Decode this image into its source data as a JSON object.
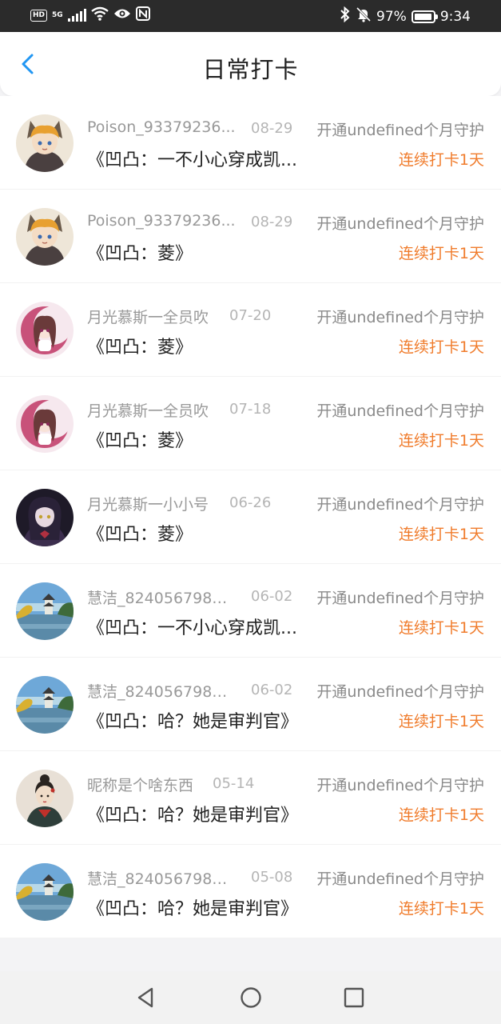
{
  "status_bar": {
    "hd_badge": "HD",
    "network": "5G",
    "battery_percent": "97%",
    "battery_level": 0.97,
    "time": "9:34",
    "icons": [
      "signal-icon",
      "wifi-icon",
      "eye-icon",
      "nfc-icon",
      "bluetooth-icon",
      "bell-off-icon",
      "battery-icon"
    ]
  },
  "header": {
    "title": "日常打卡",
    "back_icon": "chevron-left-icon",
    "accent_color": "#2196f3"
  },
  "checkins": [
    {
      "name": "Poison_93379236...",
      "date": "08-29",
      "guard": "开通undefined个月守护",
      "book": "《凹凸：一不小心穿成凯...",
      "streak": "连续打卡1天",
      "avatar": "anime-catboy"
    },
    {
      "name": "Poison_93379236...",
      "date": "08-29",
      "guard": "开通undefined个月守护",
      "book": "《凹凸：菱》",
      "streak": "连续打卡1天",
      "avatar": "anime-catboy"
    },
    {
      "name": "月光慕斯一全员吹",
      "date": "07-20",
      "guard": "开通undefined个月守护",
      "book": "《凹凸：菱》",
      "streak": "连续打卡1天",
      "avatar": "anime-pink-moon"
    },
    {
      "name": "月光慕斯一全员吹",
      "date": "07-18",
      "guard": "开通undefined个月守护",
      "book": "《凹凸：菱》",
      "streak": "连续打卡1天",
      "avatar": "anime-pink-moon"
    },
    {
      "name": "月光慕斯一小小号",
      "date": "06-26",
      "guard": "开通undefined个月守护",
      "book": "《凹凸：菱》",
      "streak": "连续打卡1天",
      "avatar": "anime-dark"
    },
    {
      "name": "慧洁_8240567985...",
      "date": "06-02",
      "guard": "开通undefined个月守护",
      "book": "《凹凸：一不小心穿成凯...",
      "streak": "连续打卡1天",
      "avatar": "landscape-pagoda"
    },
    {
      "name": "慧洁_8240567985...",
      "date": "06-02",
      "guard": "开通undefined个月守护",
      "book": "《凹凸：哈？她是审判官》",
      "streak": "连续打卡1天",
      "avatar": "landscape-pagoda"
    },
    {
      "name": "昵称是个啥东西",
      "date": "05-14",
      "guard": "开通undefined个月守护",
      "book": "《凹凸：哈？她是审判官》",
      "streak": "连续打卡1天",
      "avatar": "painted-lady"
    },
    {
      "name": "慧洁_8240567985...",
      "date": "05-08",
      "guard": "开通undefined个月守护",
      "book": "《凹凸：哈？她是审判官》",
      "streak": "连续打卡1天",
      "avatar": "landscape-pagoda"
    }
  ],
  "nav_bar": {
    "back_icon": "triangle-back-icon",
    "home_icon": "circle-home-icon",
    "recents_icon": "square-recents-icon"
  },
  "colors": {
    "streak": "#f07c2c",
    "muted_text": "#999999",
    "primary_text": "#222222"
  }
}
